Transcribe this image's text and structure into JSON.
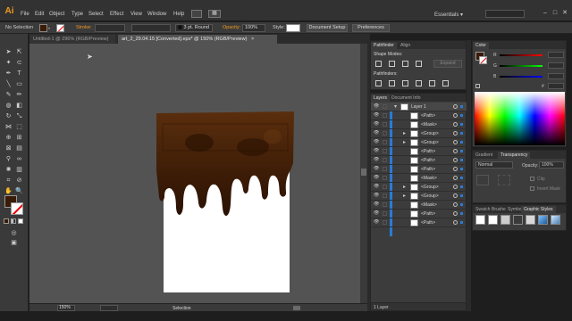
{
  "app": {
    "logo": "Ai",
    "workspace": "Essentials",
    "workspace_arrow": "▾"
  },
  "menu": [
    "File",
    "Edit",
    "Object",
    "Type",
    "Select",
    "Effect",
    "View",
    "Window",
    "Help"
  ],
  "control_bar": {
    "selection_label": "No Selection",
    "stroke_label": "Stroke:",
    "brush": "3 pt. Round",
    "opacity_label": "Opacity:",
    "opacity_value": "100%",
    "style_label": "Style:",
    "document_setup": "Document Setup",
    "preferences": "Preferences"
  },
  "doc_tabs": [
    {
      "label": "Untitled-1 @ 296% (RGB/Preview)",
      "active": false
    },
    {
      "label": "art_2_29.04.15 [Converted].eps* @ 150% (RGB/Preview)",
      "active": true
    }
  ],
  "status": {
    "zoom": "150%",
    "tool": "Selection"
  },
  "pathfinder": {
    "tabs": [
      "Pathfinder",
      "Align"
    ],
    "shape_modes_label": "Shape Modes:",
    "expand": "Expand",
    "pathfinders_label": "Pathfinders:"
  },
  "layers": {
    "tabs": [
      "Layers",
      "Document Info"
    ],
    "rows": [
      "Layer 1",
      "<Path>",
      "<Mask>",
      "<Group>",
      "<Group>",
      "<Path>",
      "<Path>",
      "<Path>",
      "<Mask>",
      "<Group>",
      "<Group>",
      "<Mask>",
      "<Path>",
      "<Path>"
    ],
    "footer": "1 Layer"
  },
  "color_panel": {
    "tabs": [
      "Color"
    ],
    "channels": [
      "R",
      "G",
      "B"
    ],
    "hex": "#"
  },
  "gradient_panel": {
    "tabs": [
      "Gradient",
      "Transparency"
    ],
    "blend_mode": "Normal",
    "opacity_label": "Opacity:",
    "opacity_value": "100%",
    "clip": "Clip",
    "invert_mask": "Invert Mask"
  },
  "swatches_panel": {
    "tabs": [
      "Swatch",
      "Brushe",
      "Symbo",
      "Graphic Styles"
    ]
  },
  "colors": {
    "chocolate": "#3a1c06",
    "chocolate_dark": "#1e0b00",
    "accent_orange": "#f29a1f",
    "selection_blue": "#2a7bd4"
  }
}
